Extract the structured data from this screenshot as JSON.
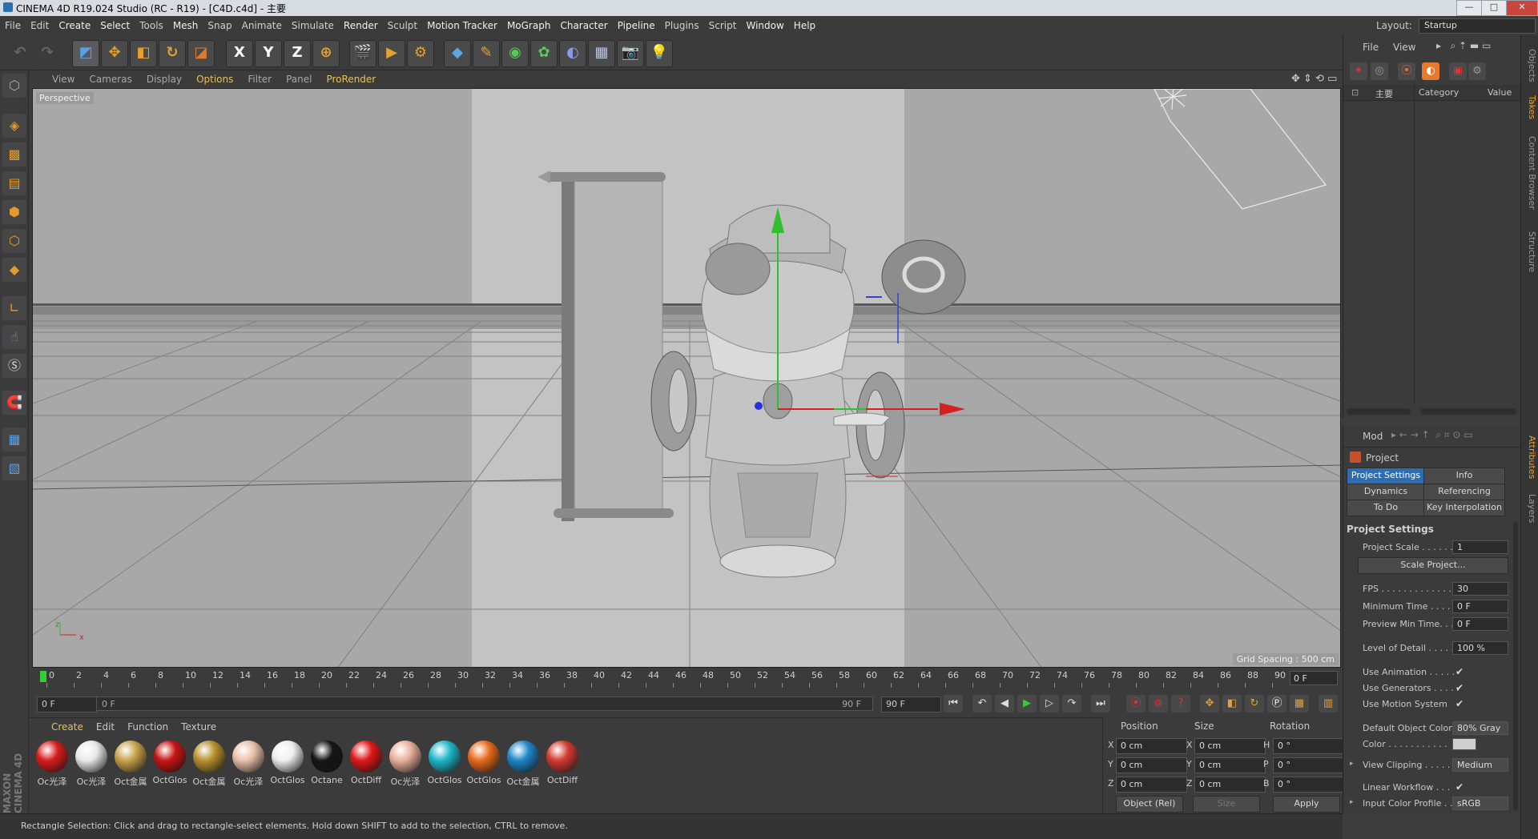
{
  "window": {
    "title": "CINEMA 4D R19.024 Studio (RC - R19) - [C4D.c4d] - 主要",
    "controls": {
      "minimize": "—",
      "maximize": "□",
      "close": "✕"
    }
  },
  "menubar": [
    "File",
    "Edit",
    "Create",
    "Select",
    "Tools",
    "Mesh",
    "Snap",
    "Animate",
    "Simulate",
    "Render",
    "Sculpt",
    "Motion Tracker",
    "MoGraph",
    "Character",
    "Pipeline",
    "Plugins",
    "Script",
    "Window",
    "Help"
  ],
  "layout": {
    "label": "Layout:",
    "value": "Startup"
  },
  "viewport": {
    "menu": [
      "View",
      "Cameras",
      "Display",
      "Options",
      "Filter",
      "Panel",
      "ProRender"
    ],
    "label": "Perspective",
    "grid_spacing": "Grid Spacing : 500 cm",
    "axis_z": "z",
    "axis_x": "x"
  },
  "toolbar": {
    "axis_x": "X",
    "axis_y": "Y",
    "axis_z": "Z"
  },
  "timeline": {
    "ticks": [
      "0",
      "2",
      "4",
      "6",
      "8",
      "10",
      "12",
      "14",
      "16",
      "18",
      "20",
      "22",
      "24",
      "26",
      "28",
      "30",
      "32",
      "34",
      "36",
      "38",
      "40",
      "42",
      "44",
      "46",
      "48",
      "50",
      "52",
      "54",
      "56",
      "58",
      "60",
      "62",
      "64",
      "66",
      "68",
      "70",
      "72",
      "74",
      "76",
      "78",
      "80",
      "82",
      "84",
      "86",
      "88",
      "90"
    ],
    "current_frame": "0 F"
  },
  "playback": {
    "start": "0 F",
    "range_start": "0 F",
    "range_end": "90 F",
    "end": "90 F"
  },
  "materials": {
    "menu": [
      "Create",
      "Edit",
      "Function",
      "Texture"
    ],
    "items": [
      {
        "name": "Oc光泽",
        "color": "#d91c1c"
      },
      {
        "name": "Oc光泽",
        "color": "#e8e8e8"
      },
      {
        "name": "Oct金属",
        "color": "#c9a24a"
      },
      {
        "name": "OctGlos",
        "color": "#c81414"
      },
      {
        "name": "Oct金属",
        "color": "#b8912e"
      },
      {
        "name": "Oc光泽",
        "color": "#e8c0a8"
      },
      {
        "name": "OctGlos",
        "color": "#eeeeee"
      },
      {
        "name": "Octane",
        "color": "#161616"
      },
      {
        "name": "OctDiff",
        "color": "#e01818"
      },
      {
        "name": "Oc光泽",
        "color": "#eab09a"
      },
      {
        "name": "OctGlos",
        "color": "#1fb7c9"
      },
      {
        "name": "OctGlos",
        "color": "#e86a1c"
      },
      {
        "name": "Oct金属",
        "color": "#1e86c8"
      },
      {
        "name": "OctDiff",
        "color": "#d43a32"
      }
    ]
  },
  "coords": {
    "headers": [
      "Position",
      "Size",
      "Rotation"
    ],
    "rows": [
      {
        "axis": "X",
        "pos": "0 cm",
        "size_axis": "X",
        "size": "0 cm",
        "rot_axis": "H",
        "rot": "0 °"
      },
      {
        "axis": "Y",
        "pos": "0 cm",
        "size_axis": "Y",
        "size": "0 cm",
        "rot_axis": "P",
        "rot": "0 °"
      },
      {
        "axis": "Z",
        "pos": "0 cm",
        "size_axis": "Z",
        "size": "0 cm",
        "rot_axis": "B",
        "rot": "0 °"
      }
    ],
    "mode": "Object (Rel)",
    "size_mode": "Size",
    "apply": "Apply"
  },
  "status": "Rectangle Selection: Click and drag to rectangle-select elements. Hold down SHIFT to add to the selection, CTRL to remove.",
  "objects": {
    "menu": [
      "File",
      "View"
    ],
    "col_name": "主要",
    "col_category": "Category",
    "col_value": "Value"
  },
  "attributes": {
    "mode": "Mod",
    "section": "Project",
    "tabs": [
      "Project Settings",
      "Info",
      "Dynamics",
      "Referencing",
      "To Do",
      "Key Interpolation"
    ],
    "group": "Project Settings",
    "project_scale_label": "Project Scale . . . . . .",
    "project_scale": "1",
    "scale_project": "Scale Project...",
    "fps_label": "FPS . . . . . . . . . . . . . .",
    "fps": "30",
    "min_time_label": "Minimum Time . . . . .",
    "min_time": "0 F",
    "preview_min_label": "Preview Min Time. . .",
    "preview_min": "0 F",
    "lod_label": "Level of Detail . . . . . .",
    "lod": "100 %",
    "use_animation": "Use Animation . . . . .",
    "use_generators": "Use Generators . . . . .",
    "use_motion": "Use Motion System",
    "default_color_label": "Default Object Color",
    "default_color": "80% Gray",
    "color_label": "Color . . . . . . . . . . .",
    "view_clipping_label": "View Clipping . . . . . .",
    "view_clipping": "Medium",
    "linear_label": "Linear Workflow . . .",
    "input_profile_label": "Input Color Profile . .",
    "input_profile": "sRGB"
  },
  "side_tabs": [
    "Objects",
    "Takes",
    "Content Browser",
    "Structure",
    "Attributes",
    "Layers"
  ],
  "branding": "MAXON CINEMA 4D"
}
